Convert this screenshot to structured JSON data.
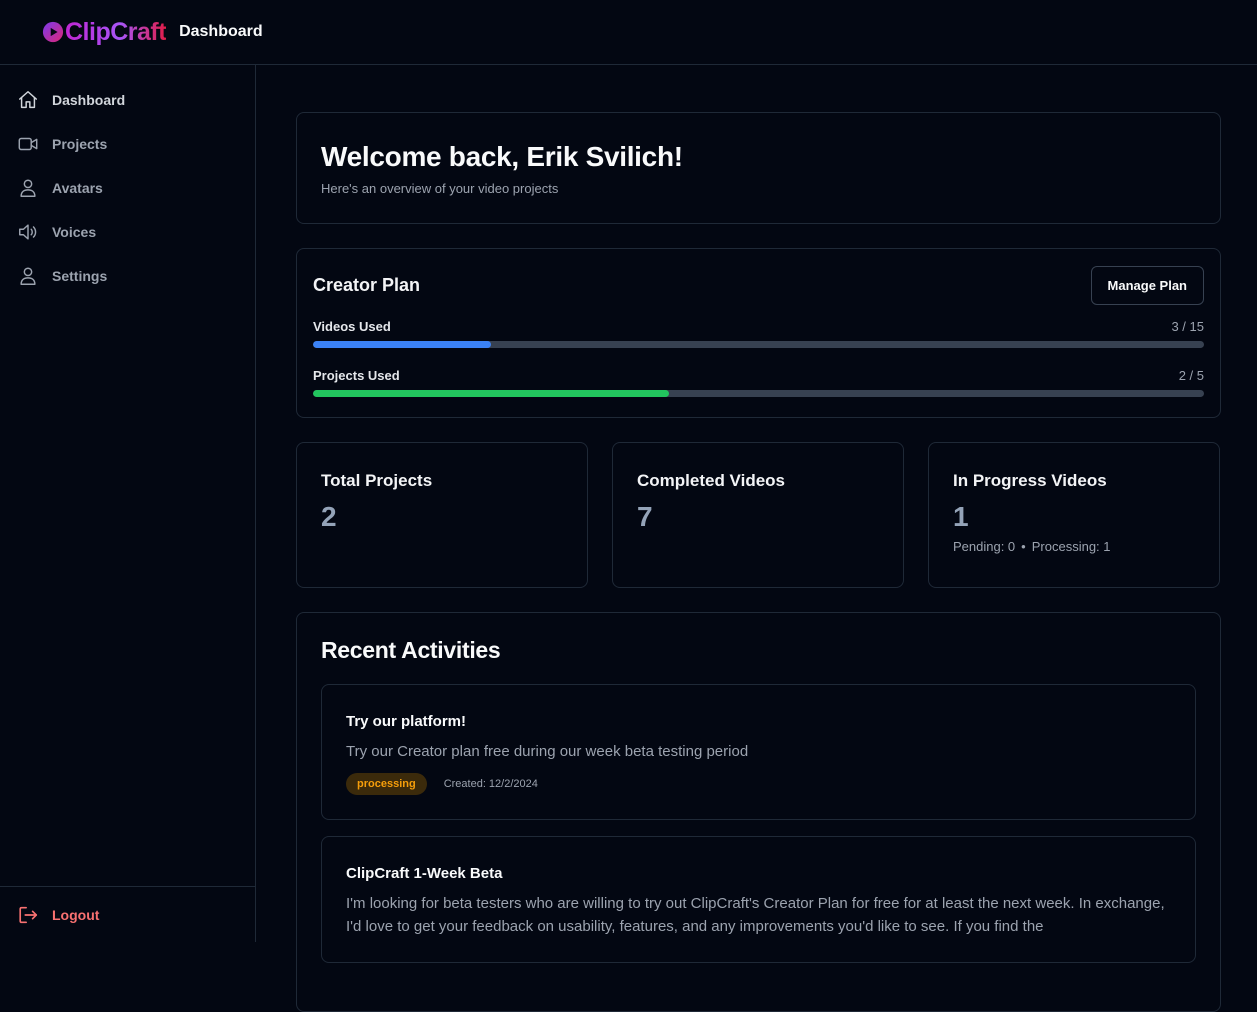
{
  "app": {
    "brand": "ClipCraft",
    "page_title": "Dashboard"
  },
  "sidebar": {
    "items": [
      {
        "label": "Dashboard",
        "icon": "home-icon"
      },
      {
        "label": "Projects",
        "icon": "video-camera-icon"
      },
      {
        "label": "Avatars",
        "icon": "user-icon"
      },
      {
        "label": "Voices",
        "icon": "speaker-icon"
      },
      {
        "label": "Settings",
        "icon": "user-icon"
      }
    ],
    "logout_label": "Logout"
  },
  "welcome": {
    "title": "Welcome back, Erik Svilich!",
    "subtitle": "Here's an overview of your video projects"
  },
  "plan": {
    "title": "Creator Plan",
    "manage_label": "Manage Plan",
    "videos": {
      "label": "Videos Used",
      "count": "3 / 15",
      "used": 3,
      "total": 15,
      "color": "#3b82f6"
    },
    "projects": {
      "label": "Projects Used",
      "count": "2 / 5",
      "used": 2,
      "total": 5,
      "color": "#22c55e"
    }
  },
  "stats": {
    "total_projects": {
      "title": "Total Projects",
      "value": "2"
    },
    "completed_videos": {
      "title": "Completed Videos",
      "value": "7"
    },
    "in_progress_videos": {
      "title": "In Progress Videos",
      "value": "1",
      "pending": "Pending: 0",
      "separator": "•",
      "processing": "Processing: 1"
    }
  },
  "recent": {
    "title": "Recent Activities",
    "items": [
      {
        "title": "Try our platform!",
        "description": "Try our Creator plan free during our week beta testing period",
        "status": "processing",
        "created": "Created: 12/2/2024"
      },
      {
        "title": "ClipCraft 1-Week Beta",
        "description": "I'm looking for beta testers who are willing to try out ClipCraft's Creator Plan for free for at least the next week. In exchange, I'd love to get your feedback on usability, features, and any improvements you'd like to see. If you find the"
      }
    ]
  }
}
